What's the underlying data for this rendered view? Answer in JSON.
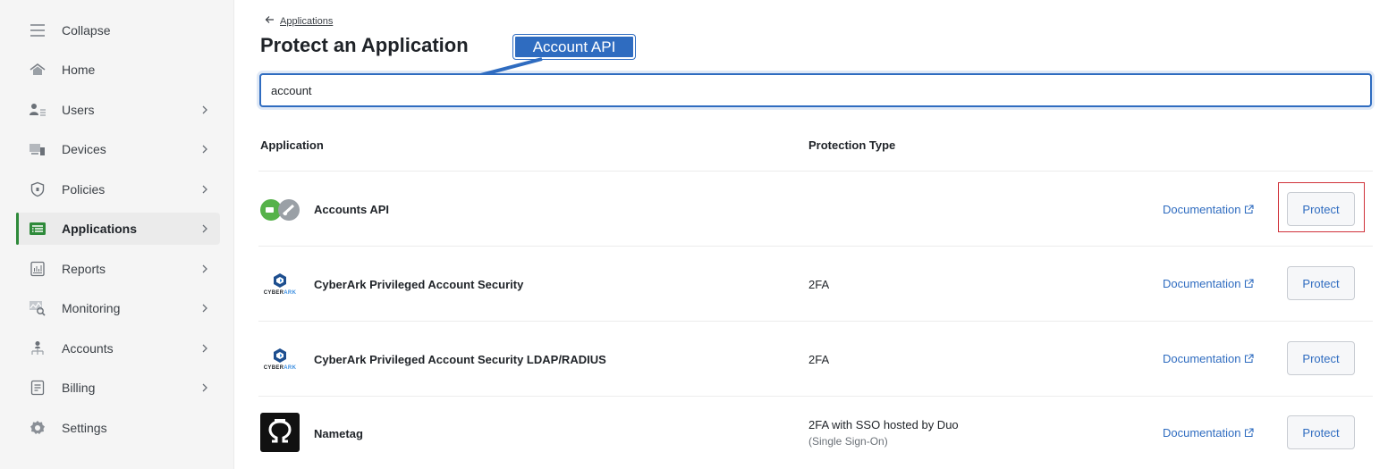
{
  "sidebar": {
    "items": [
      {
        "label": "Collapse",
        "icon": "menu-icon",
        "chevron": false
      },
      {
        "label": "Home",
        "icon": "home-icon",
        "chevron": false
      },
      {
        "label": "Users",
        "icon": "users-icon",
        "chevron": true
      },
      {
        "label": "Devices",
        "icon": "devices-icon",
        "chevron": true
      },
      {
        "label": "Policies",
        "icon": "shield-icon",
        "chevron": true
      },
      {
        "label": "Applications",
        "icon": "applications-icon",
        "chevron": true,
        "active": true
      },
      {
        "label": "Reports",
        "icon": "reports-icon",
        "chevron": true
      },
      {
        "label": "Monitoring",
        "icon": "monitoring-icon",
        "chevron": true
      },
      {
        "label": "Accounts",
        "icon": "accounts-icon",
        "chevron": true
      },
      {
        "label": "Billing",
        "icon": "billing-icon",
        "chevron": true
      },
      {
        "label": "Settings",
        "icon": "gear-icon",
        "chevron": false
      }
    ]
  },
  "header": {
    "back_label": "Applications",
    "title": "Protect an Application"
  },
  "annotation": {
    "callout_text": "Account API"
  },
  "search": {
    "value": "account"
  },
  "table": {
    "col_application": "Application",
    "col_protection": "Protection Type",
    "rows": [
      {
        "name": "Accounts API",
        "protection": "",
        "protection_sub": "",
        "doc": "Documentation",
        "action": "Protect",
        "logo": "accounts-api-logo"
      },
      {
        "name": "CyberArk Privileged Account Security",
        "protection": "2FA",
        "protection_sub": "",
        "doc": "Documentation",
        "action": "Protect",
        "logo": "cyberark-logo"
      },
      {
        "name": "CyberArk Privileged Account Security LDAP/RADIUS",
        "protection": "2FA",
        "protection_sub": "",
        "doc": "Documentation",
        "action": "Protect",
        "logo": "cyberark-logo"
      },
      {
        "name": "Nametag",
        "protection": "2FA with SSO hosted by Duo",
        "protection_sub": "(Single Sign-On)",
        "doc": "Documentation",
        "action": "Protect",
        "logo": "nametag-logo"
      }
    ]
  },
  "logos": {
    "cyberark_text_1": "CYBER",
    "cyberark_text_2": "ARK"
  },
  "colors": {
    "accent": "#2f6cc0",
    "active_green": "#2e8a3a",
    "highlight_red": "#d0323a",
    "callout_blue": "#2f6cc0"
  }
}
